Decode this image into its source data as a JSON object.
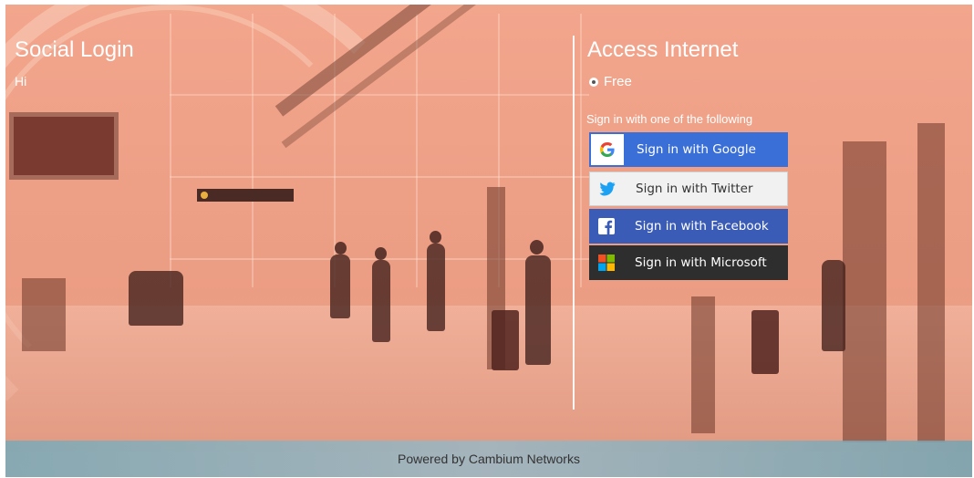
{
  "left_panel": {
    "title": "Social Login",
    "greeting": "Hi"
  },
  "right_panel": {
    "title": "Access Internet",
    "plan_option": "Free",
    "signin_prompt": "Sign in with one of the following",
    "buttons": [
      {
        "label": "Sign in with Google",
        "icon": "google-icon",
        "color": "#3a6fd8"
      },
      {
        "label": "Sign in with Twitter",
        "icon": "twitter-icon",
        "color": "#f1f1f1"
      },
      {
        "label": "Sign in with Facebook",
        "icon": "facebook-icon",
        "color": "#3b5cb6"
      },
      {
        "label": "Sign in with Microsoft",
        "icon": "microsoft-icon",
        "color": "#2e2e2e"
      }
    ]
  },
  "footer": {
    "text": "Powered by Cambium Networks"
  }
}
